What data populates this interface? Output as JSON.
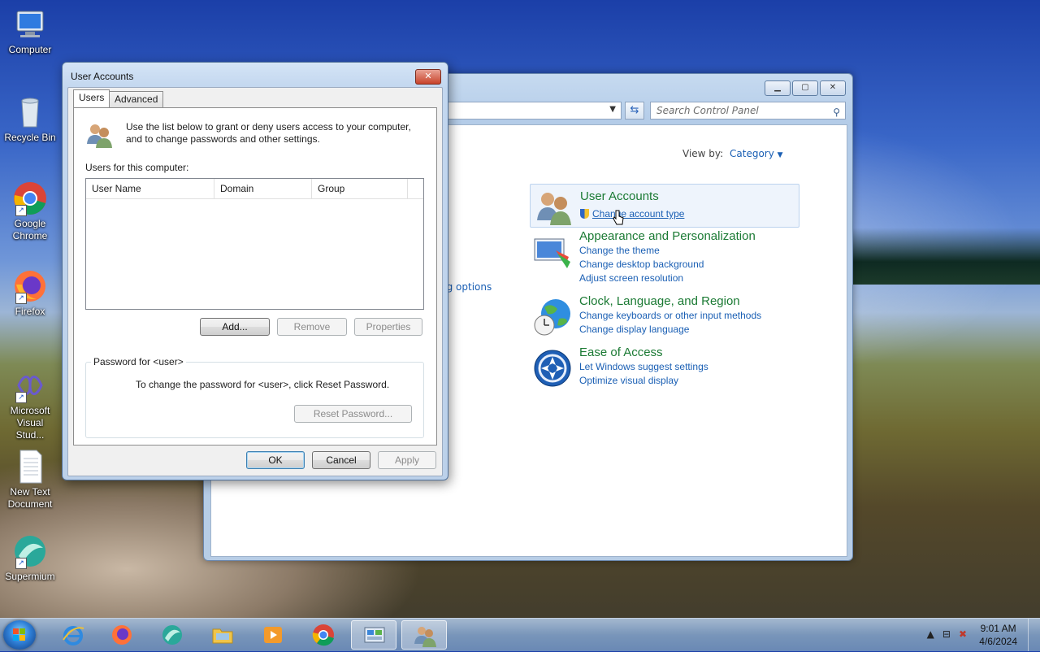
{
  "desktop": {
    "icons": [
      {
        "label": "Computer"
      },
      {
        "label": "Recycle Bin"
      },
      {
        "label": "Google Chrome"
      },
      {
        "label": "Firefox"
      },
      {
        "label": "Microsoft Visual Stud..."
      },
      {
        "label": "New Text Document"
      },
      {
        "label": "Supermium"
      }
    ]
  },
  "control_panel": {
    "search_placeholder": "Search Control Panel",
    "view_by_label": "View by:",
    "view_by_value": "Category",
    "left_link_fragment": "ng options",
    "categories": [
      {
        "title": "User Accounts",
        "links": [
          "Change account type"
        ]
      },
      {
        "title": "Appearance and Personalization",
        "links": [
          "Change the theme",
          "Change desktop background",
          "Adjust screen resolution"
        ]
      },
      {
        "title": "Clock, Language, and Region",
        "links": [
          "Change keyboards or other input methods",
          "Change display language"
        ]
      },
      {
        "title": "Ease of Access",
        "links": [
          "Let Windows suggest settings",
          "Optimize visual display"
        ]
      }
    ]
  },
  "user_accounts_dialog": {
    "title": "User Accounts",
    "close_label": "✕",
    "tabs": [
      {
        "label": "Users"
      },
      {
        "label": "Advanced"
      }
    ],
    "intro": "Use the list below to grant or deny users access to your computer, and to change passwords and other settings.",
    "users_label": "Users for this computer:",
    "columns": [
      "User Name",
      "Domain",
      "Group"
    ],
    "buttons": {
      "add": "Add...",
      "remove": "Remove",
      "properties": "Properties",
      "reset_password": "Reset Password...",
      "ok": "OK",
      "cancel": "Cancel",
      "apply": "Apply"
    },
    "password_group_title": "Password for <user>",
    "password_text": "To change the password for <user>, click Reset Password."
  },
  "taskbar": {
    "time": "9:01 AM",
    "date": "4/6/2024",
    "apps": [
      "internet-explorer",
      "firefox",
      "supermium",
      "file-explorer",
      "media-player",
      "chrome",
      "control-panel",
      "user-accounts"
    ]
  }
}
